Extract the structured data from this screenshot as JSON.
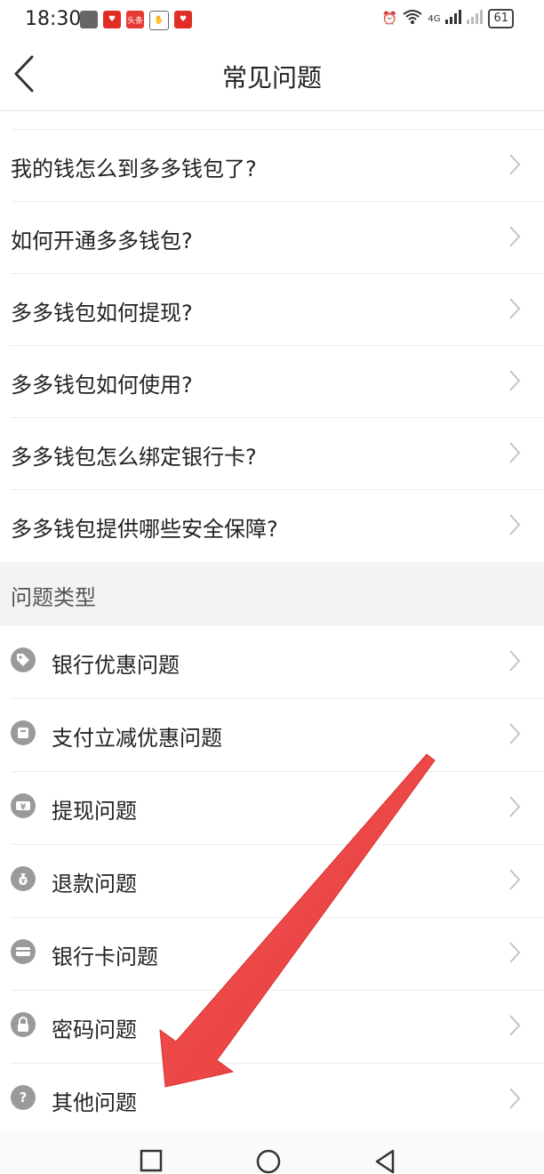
{
  "status_bar": {
    "time": "18:30",
    "network": "4G",
    "battery": "61",
    "left_app_icons": [
      "app-icon-1",
      "pinduoduo-icon",
      "toutiao-icon",
      "hand-icon",
      "pinduoduo-icon-2"
    ],
    "toutiao_label": "头条"
  },
  "header": {
    "title": "常见问题",
    "back_icon": "chevron-left-icon"
  },
  "faq": {
    "items": [
      {
        "label": "我的钱怎么到多多钱包了?"
      },
      {
        "label": "如何开通多多钱包?"
      },
      {
        "label": "多多钱包如何提现?"
      },
      {
        "label": "多多钱包如何使用?"
      },
      {
        "label": "多多钱包怎么绑定银行卡?"
      },
      {
        "label": "多多钱包提供哪些安全保障?"
      }
    ]
  },
  "categories": {
    "title": "问题类型",
    "items": [
      {
        "label": "银行优惠问题",
        "icon": "tag-icon"
      },
      {
        "label": "支付立减优惠问题",
        "icon": "box-icon"
      },
      {
        "label": "提现问题",
        "icon": "yuan-ticket-icon"
      },
      {
        "label": "退款问题",
        "icon": "money-bag-icon"
      },
      {
        "label": "银行卡问题",
        "icon": "card-icon"
      },
      {
        "label": "密码问题",
        "icon": "lock-icon"
      },
      {
        "label": "其他问题",
        "icon": "question-icon"
      }
    ]
  },
  "colors": {
    "arrow": "#f04a4a",
    "icon_gray": "#9a9a9a",
    "section_bg": "#f3f3f3"
  },
  "nav": {
    "icons": [
      "recent-apps-icon",
      "home-icon",
      "back-triangle-icon"
    ]
  }
}
